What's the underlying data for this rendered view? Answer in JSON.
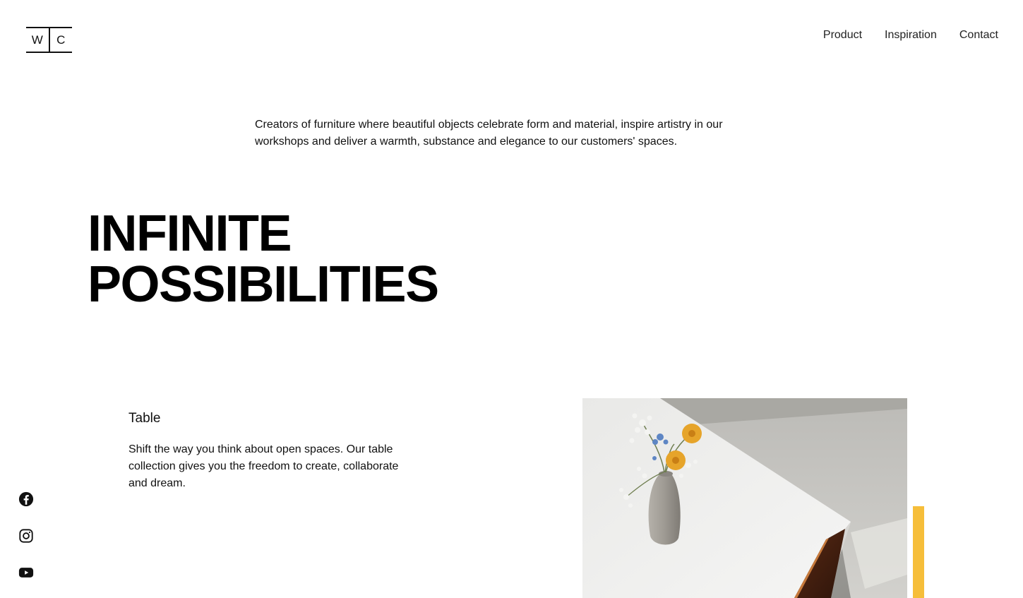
{
  "brand": {
    "logo_left": "W",
    "logo_right": "C"
  },
  "nav": {
    "items": [
      "Product",
      "Inspiration",
      "Contact"
    ]
  },
  "intro": {
    "text": "Creators of furniture where beautiful objects celebrate form and material, inspire artistry in our workshops and deliver a warmth, substance and elegance to our customers' spaces."
  },
  "hero": {
    "line1": "INFINITE",
    "line2": "POSSIBILITIES"
  },
  "feature": {
    "title": "Table",
    "description": "Shift the way you think about open spaces. Our table collection gives you the freedom to create, collaborate and dream."
  },
  "social": {
    "icons": [
      "facebook-icon",
      "instagram-icon",
      "youtube-icon"
    ]
  },
  "colors": {
    "accent": "#F6BE3A",
    "text": "#111111",
    "background": "#FFFFFF"
  }
}
